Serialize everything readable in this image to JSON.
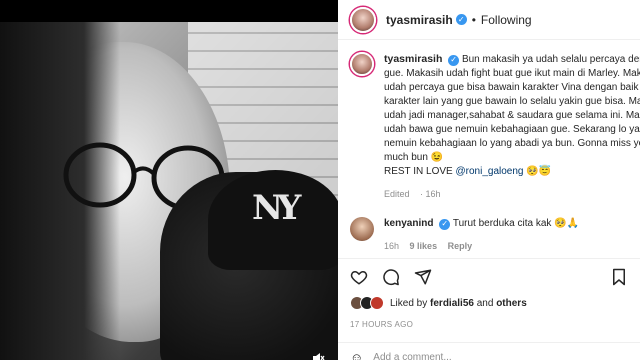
{
  "post": {
    "username": "tyasmirasih",
    "follow_state": "Following",
    "caption_lines": [
      "Bun makasih ya udah selalu percaya dengan t",
      "gue. Makasih udah fight buat gue ikut main di Marley. Makas",
      "udah percaya gue bisa bawain karakter Vina dengan baik dar",
      "karakter lain yang gue bawain lo selalu yakin gue bisa. Makas",
      "udah jadi manager,sahabat & saudara gue selama ini. Makas",
      "udah bawa gue nemuin kebahagiaan gue. Sekarang lo yang",
      "nemuin kebahagiaan lo yang abadi ya bun. Gonna miss you s",
      "much bun 😉"
    ],
    "rest_in_love": "REST IN LOVE",
    "mention": "@roni_galoeng",
    "rest_emojis": "🥺😇",
    "edited_label": "Edited",
    "edited_time": "16h"
  },
  "comment": {
    "username": "kenyanind",
    "text": "Turut berduka cita kak 🥺🙏",
    "time": "16h",
    "likes": "9 likes",
    "reply": "Reply"
  },
  "likes": {
    "prefix": "Liked by",
    "user": "ferdiali56",
    "and": "and",
    "others": "others"
  },
  "timestamp": "17 HOURS AGO",
  "add_comment_placeholder": "Add a comment...",
  "media": {
    "cap_logo": "NY"
  },
  "colors": {
    "verified": "#3897f0",
    "mention": "#00376b",
    "muted": "#8e8e8e"
  }
}
